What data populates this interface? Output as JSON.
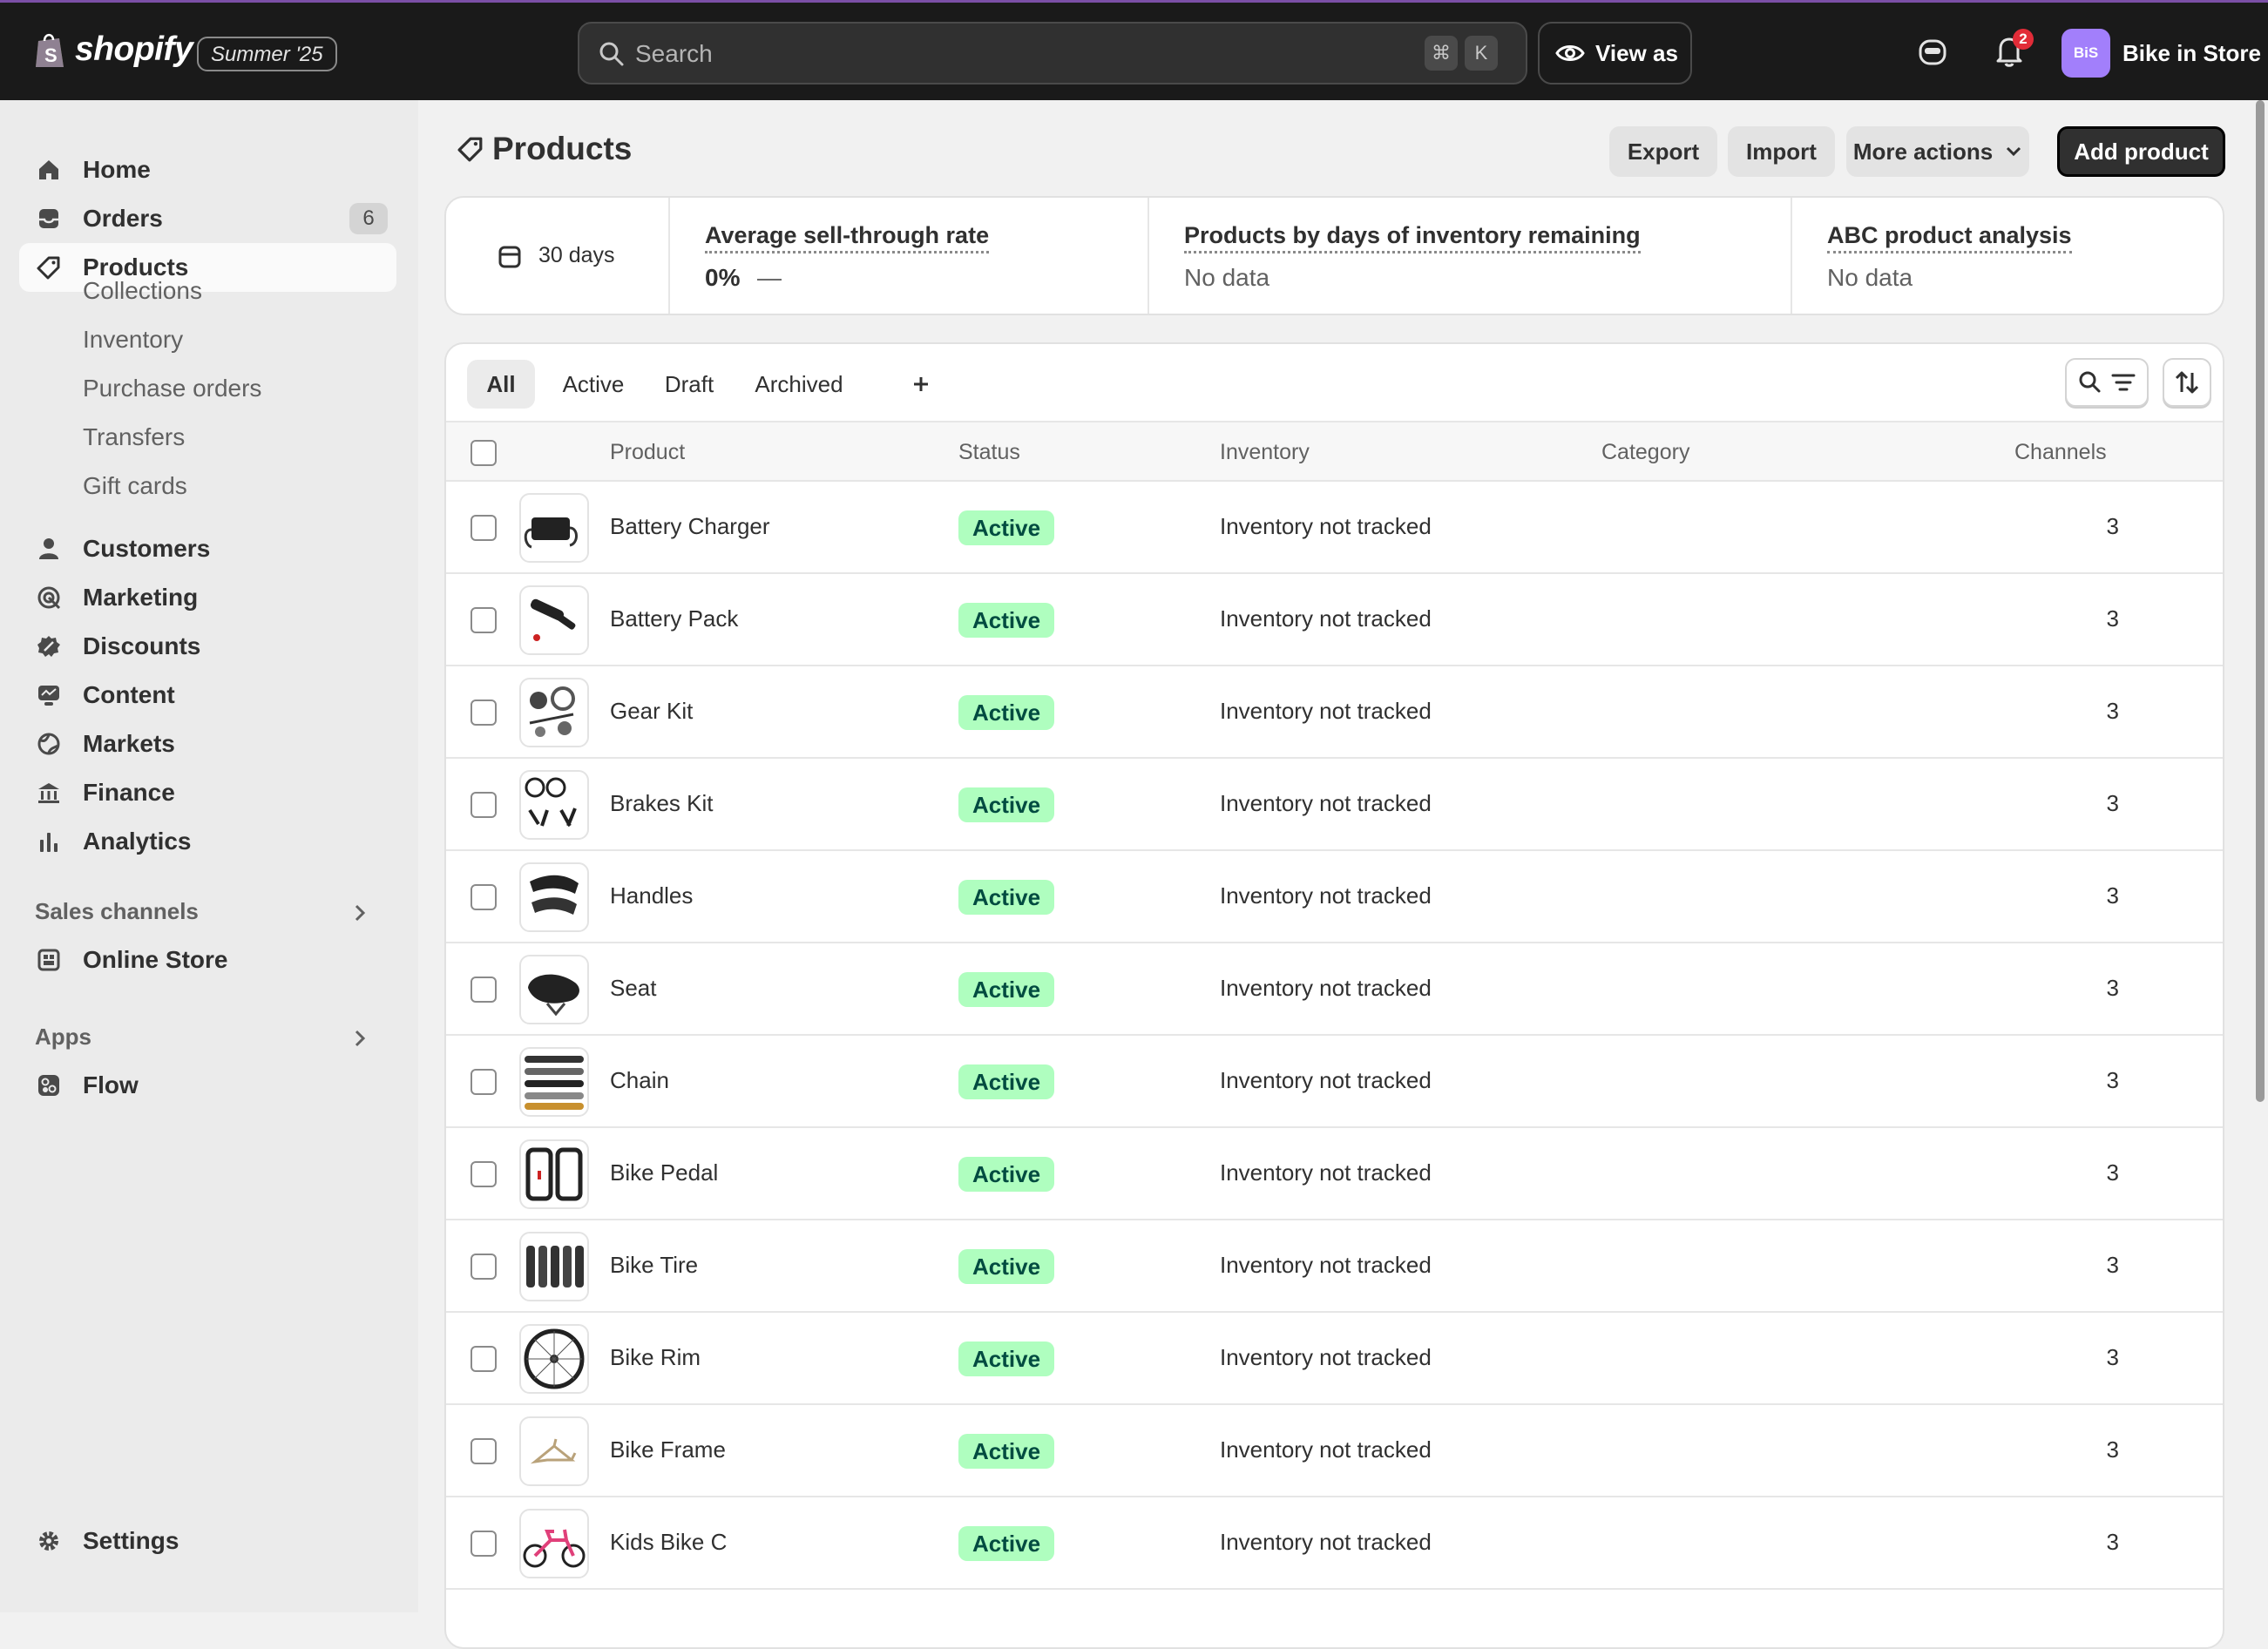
{
  "topbar": {
    "logo_text": "shopify",
    "edition": "Summer '25",
    "search_placeholder": "Search",
    "shortcut_cmd": "⌘",
    "shortcut_key": "K",
    "view_as_label": "View as",
    "notification_count": "2",
    "store_initials": "BiS",
    "store_name": "Bike in Store"
  },
  "sidebar": {
    "home": "Home",
    "orders": "Orders",
    "orders_count": "6",
    "products": "Products",
    "collections": "Collections",
    "inventory": "Inventory",
    "purchase_orders": "Purchase orders",
    "transfers": "Transfers",
    "gift_cards": "Gift cards",
    "customers": "Customers",
    "marketing": "Marketing",
    "discounts": "Discounts",
    "content": "Content",
    "markets": "Markets",
    "finance": "Finance",
    "analytics": "Analytics",
    "sales_channels": "Sales channels",
    "online_store": "Online Store",
    "apps": "Apps",
    "flow": "Flow",
    "settings": "Settings"
  },
  "page": {
    "title": "Products",
    "export": "Export",
    "import": "Import",
    "more_actions": "More actions",
    "add_product": "Add product"
  },
  "metrics": {
    "period": "30 days",
    "sell_through_title": "Average sell-through rate",
    "sell_through_value": "0%",
    "sell_through_trend": "—",
    "days_inventory_title": "Products by days of inventory remaining",
    "days_inventory_value": "No data",
    "abc_title": "ABC product analysis",
    "abc_value": "No data"
  },
  "tabs": [
    "All",
    "Active",
    "Draft",
    "Archived"
  ],
  "table": {
    "headers": {
      "product": "Product",
      "status": "Status",
      "inventory": "Inventory",
      "category": "Category",
      "channels": "Channels"
    },
    "rows": [
      {
        "name": "Battery Charger",
        "status": "Active",
        "inventory": "Inventory not tracked",
        "category": "",
        "channels": "3"
      },
      {
        "name": "Battery Pack",
        "status": "Active",
        "inventory": "Inventory not tracked",
        "category": "",
        "channels": "3"
      },
      {
        "name": "Gear Kit",
        "status": "Active",
        "inventory": "Inventory not tracked",
        "category": "",
        "channels": "3"
      },
      {
        "name": "Brakes Kit",
        "status": "Active",
        "inventory": "Inventory not tracked",
        "category": "",
        "channels": "3"
      },
      {
        "name": "Handles",
        "status": "Active",
        "inventory": "Inventory not tracked",
        "category": "",
        "channels": "3"
      },
      {
        "name": "Seat",
        "status": "Active",
        "inventory": "Inventory not tracked",
        "category": "",
        "channels": "3"
      },
      {
        "name": "Chain",
        "status": "Active",
        "inventory": "Inventory not tracked",
        "category": "",
        "channels": "3"
      },
      {
        "name": "Bike Pedal",
        "status": "Active",
        "inventory": "Inventory not tracked",
        "category": "",
        "channels": "3"
      },
      {
        "name": "Bike Tire",
        "status": "Active",
        "inventory": "Inventory not tracked",
        "category": "",
        "channels": "3"
      },
      {
        "name": "Bike Rim",
        "status": "Active",
        "inventory": "Inventory not tracked",
        "category": "",
        "channels": "3"
      },
      {
        "name": "Bike Frame",
        "status": "Active",
        "inventory": "Inventory not tracked",
        "category": "",
        "channels": "3"
      },
      {
        "name": "Kids Bike C",
        "status": "Active",
        "inventory": "Inventory not tracked",
        "category": "",
        "channels": "3"
      }
    ]
  },
  "colors": {
    "topbar_bg": "#1a1a1a",
    "active_badge_bg": "#affebf",
    "active_badge_text": "#014b40",
    "store_avatar": "#a27ffb",
    "notification": "#e22c38"
  }
}
